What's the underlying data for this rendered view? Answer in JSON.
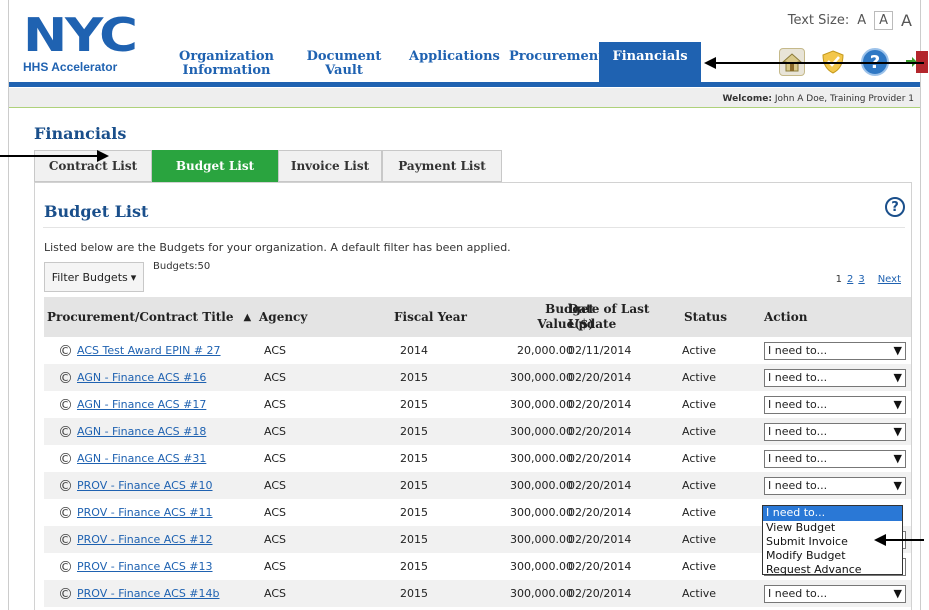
{
  "header": {
    "logo_text": "NYC",
    "logo_sub": "HHS Accelerator",
    "text_size_label": "Text Size:",
    "text_size_options": [
      "A",
      "A",
      "A"
    ],
    "tabs": [
      {
        "label": "Organization Information",
        "active": false
      },
      {
        "label": "Document Vault",
        "active": false
      },
      {
        "label": "Applications",
        "active": false
      },
      {
        "label": "Procurements",
        "active": false
      },
      {
        "label": "Financials",
        "active": true
      }
    ],
    "welcome_label": "Welcome:",
    "welcome_user": "John A Doe, Training Provider 1",
    "icons": [
      "home-icon",
      "shield-icon",
      "help-icon",
      "exit-icon"
    ]
  },
  "section_title": "Financials",
  "subtabs": [
    {
      "label": "Contract List",
      "active": false
    },
    {
      "label": "Budget List",
      "active": true
    },
    {
      "label": "Invoice List",
      "active": false
    },
    {
      "label": "Payment List",
      "active": false
    }
  ],
  "panel": {
    "title": "Budget List",
    "help_glyph": "?",
    "description": "Listed below are the Budgets for your organization. A default filter has been applied.",
    "filter_label": "Filter Budgets",
    "budget_count": "Budgets:50",
    "pager": {
      "pages": [
        "1",
        "2",
        "3"
      ],
      "next": "Next"
    }
  },
  "table": {
    "headers": {
      "title": "Procurement/Contract Title",
      "agency": "Agency",
      "fiscal_year": "Fiscal Year",
      "budget_value_1": "Budget",
      "budget_value_2": "Value($)",
      "date_1": "Date of Last",
      "date_2": "Update",
      "status": "Status",
      "action": "Action"
    },
    "rows": [
      {
        "title": "ACS Test Award EPIN # 27",
        "agency": "ACS",
        "fy": "2014",
        "value": "20,000.00",
        "date": "02/11/2014",
        "status": "Active",
        "action": "I need to..."
      },
      {
        "title": "AGN - Finance ACS #16",
        "agency": "ACS",
        "fy": "2015",
        "value": "300,000.00",
        "date": "02/20/2014",
        "status": "Active",
        "action": "I need to..."
      },
      {
        "title": "AGN - Finance ACS #17",
        "agency": "ACS",
        "fy": "2015",
        "value": "300,000.00",
        "date": "02/20/2014",
        "status": "Active",
        "action": "I need to..."
      },
      {
        "title": "AGN - Finance ACS #18",
        "agency": "ACS",
        "fy": "2015",
        "value": "300,000.00",
        "date": "02/20/2014",
        "status": "Active",
        "action": "I need to..."
      },
      {
        "title": "AGN - Finance ACS #31",
        "agency": "ACS",
        "fy": "2015",
        "value": "300,000.00",
        "date": "02/20/2014",
        "status": "Active",
        "action": "I need to..."
      },
      {
        "title": "PROV - Finance ACS #10",
        "agency": "ACS",
        "fy": "2015",
        "value": "300,000.00",
        "date": "02/20/2014",
        "status": "Active",
        "action": "I need to..."
      },
      {
        "title": "PROV - Finance ACS #11",
        "agency": "ACS",
        "fy": "2015",
        "value": "300,000.00",
        "date": "02/20/2014",
        "status": "Active",
        "action": "I need to..."
      },
      {
        "title": "PROV - Finance ACS #12",
        "agency": "ACS",
        "fy": "2015",
        "value": "300,000.00",
        "date": "02/20/2014",
        "status": "Active",
        "action": "I need to..."
      },
      {
        "title": "PROV - Finance ACS #13",
        "agency": "ACS",
        "fy": "2015",
        "value": "300,000.00",
        "date": "02/20/2014",
        "status": "Active",
        "action": "I need to..."
      },
      {
        "title": "PROV - Finance ACS #14b",
        "agency": "ACS",
        "fy": "2015",
        "value": "300,000.00",
        "date": "02/20/2014",
        "status": "Active",
        "action": "I need to..."
      }
    ]
  },
  "dropdown": {
    "selected": "I need to...",
    "options": [
      "View Budget",
      "Submit Invoice",
      "Modify Budget",
      "Request Advance"
    ]
  },
  "colors": {
    "brand_blue": "#1f62b1",
    "active_green": "#2aa43f",
    "selected_blue": "#2a78d6"
  }
}
